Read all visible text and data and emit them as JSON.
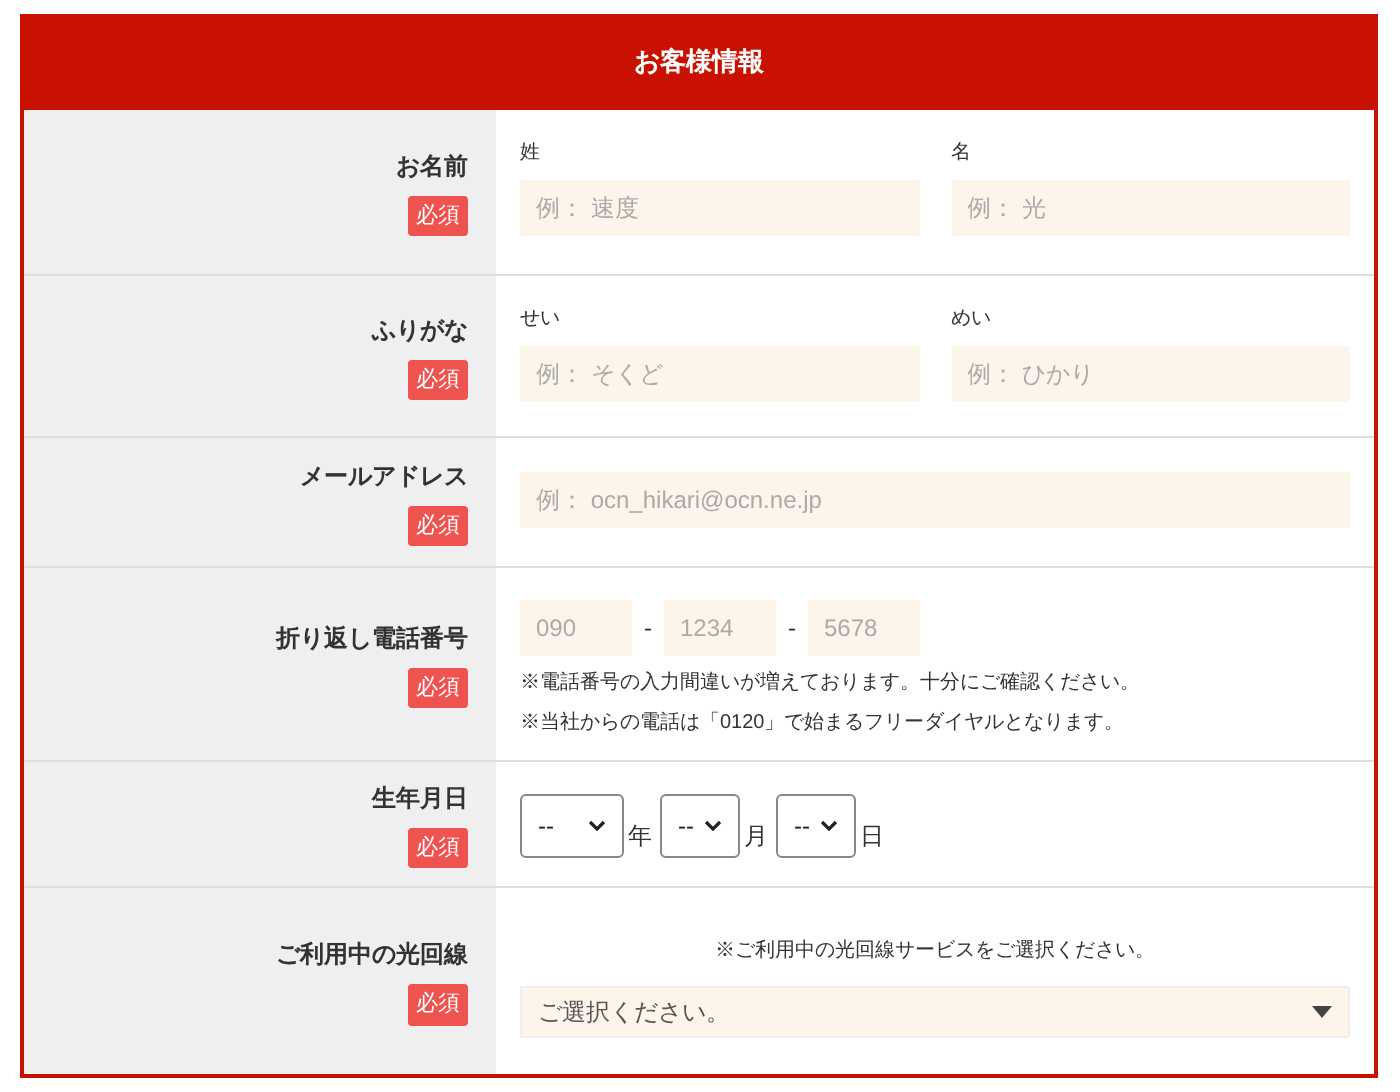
{
  "title": "お客様情報",
  "rows": [
    {
      "kind": "pair",
      "label": "お名前",
      "badge": "必須",
      "fields": [
        {
          "label": "姓",
          "placeholder": "例： 速度"
        },
        {
          "label": "名",
          "placeholder": "例： 光"
        }
      ]
    },
    {
      "kind": "pair",
      "label": "ふりがな",
      "badge": "必須",
      "fields": [
        {
          "label": "せい",
          "placeholder": "例： そくど"
        },
        {
          "label": "めい",
          "placeholder": "例： ひかり"
        }
      ]
    },
    {
      "kind": "single",
      "label": "メールアドレス",
      "badge": "必須",
      "placeholder": "例： ocn_hikari@ocn.ne.jp"
    },
    {
      "kind": "phone",
      "label": "折り返し電話番号",
      "badge": "必須",
      "parts": [
        {
          "placeholder": "090"
        },
        {
          "placeholder": "1234"
        },
        {
          "placeholder": "5678"
        }
      ],
      "separator": "-",
      "notes": [
        "※電話番号の入力間違いが増えております。十分にご確認ください。",
        "※当社からの電話は「0120」で始まるフリーダイヤルとなります。"
      ]
    },
    {
      "kind": "date",
      "label": "生年月日",
      "badge": "必須",
      "selects": [
        {
          "value": "--",
          "unit": "年"
        },
        {
          "value": "--",
          "unit": "月"
        },
        {
          "value": "--",
          "unit": "日"
        }
      ]
    },
    {
      "kind": "dropdown",
      "label": "ご利用中の光回線",
      "badge": "必須",
      "note": "※ご利用中の光回線サービスをご選択ください。",
      "value": "ご選択ください。"
    }
  ]
}
